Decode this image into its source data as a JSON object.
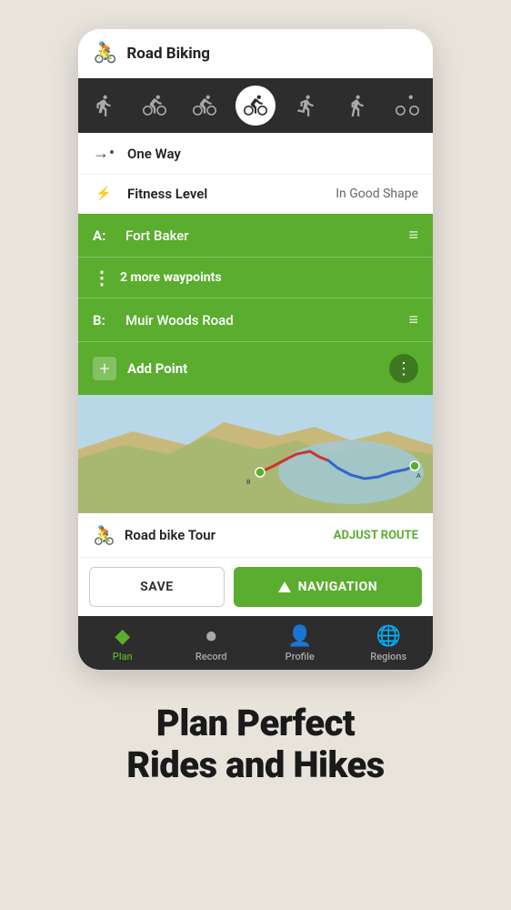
{
  "header": {
    "title": "Road Biking",
    "icon": "🚴"
  },
  "activity_types": [
    {
      "id": "walk",
      "label": "Walk",
      "active": false
    },
    {
      "id": "bike",
      "label": "Bike",
      "active": false
    },
    {
      "id": "mountain-bike",
      "label": "Mountain Bike",
      "active": false
    },
    {
      "id": "road-bike",
      "label": "Road Bike",
      "active": true
    },
    {
      "id": "hike",
      "label": "Hike",
      "active": false
    },
    {
      "id": "run",
      "label": "Run",
      "active": false
    },
    {
      "id": "ski",
      "label": "Ski",
      "active": false
    }
  ],
  "settings": {
    "route_type_label": "One Way",
    "fitness_label": "Fitness Level",
    "fitness_value": "In Good Shape"
  },
  "waypoints": {
    "point_a": "Fort Baker",
    "point_b": "Muir Woods Road",
    "more_waypoints_text": "2 more waypoints",
    "add_point_label": "Add Point"
  },
  "route": {
    "title": "Road bike Tour",
    "adjust_label": "ADJUST ROUTE"
  },
  "buttons": {
    "save_label": "SAVE",
    "navigation_label": "NAVIGATION"
  },
  "bottom_nav": [
    {
      "id": "plan",
      "label": "Plan",
      "active": true
    },
    {
      "id": "record",
      "label": "Record",
      "active": false
    },
    {
      "id": "profile",
      "label": "Profile",
      "active": false
    },
    {
      "id": "regions",
      "label": "Regions",
      "active": false
    }
  ],
  "tagline": {
    "line1": "Plan Perfect",
    "line2": "Rides and Hikes"
  }
}
